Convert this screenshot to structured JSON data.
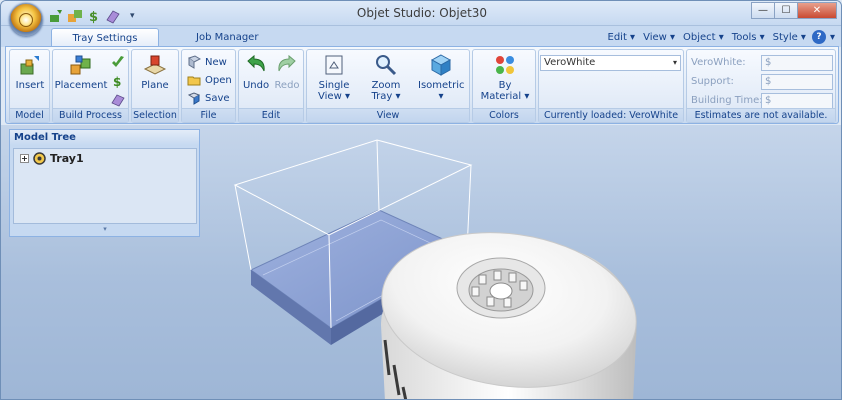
{
  "window": {
    "title": "Objet Studio: Objet30"
  },
  "qat": {
    "icons": [
      "insert-icon",
      "build-icon",
      "dollar-icon",
      "eraser-icon"
    ],
    "menu_glyph": "▾"
  },
  "controls": {
    "minimize": "—",
    "maximize": "☐",
    "close": "✕"
  },
  "tabs": [
    "Tray Settings",
    "Job Manager"
  ],
  "menus": [
    "Edit ▾",
    "View ▾",
    "Object ▾",
    "Tools ▾",
    "Style ▾"
  ],
  "help": {
    "glyph": "?",
    "arrow": "▾"
  },
  "ribbon": {
    "model": {
      "label": "Model",
      "insert": "Insert"
    },
    "build": {
      "label": "Build Process",
      "placement": "Placement"
    },
    "selection": {
      "label": "Selection",
      "plane": "Plane"
    },
    "file": {
      "label": "File",
      "new": "New",
      "open": "Open",
      "save": "Save"
    },
    "edit": {
      "label": "Edit",
      "undo": "Undo",
      "redo": "Redo"
    },
    "view": {
      "label": "View",
      "single_view": "Single View ▾",
      "zoom_tray": "Zoom Tray ▾",
      "isometric": "Isometric ▾"
    },
    "colors": {
      "label": "Colors",
      "by_material": "By Material ▾"
    },
    "material": {
      "label": "Currently loaded: VeroWhite",
      "selected": "VeroWhite"
    },
    "estimates": {
      "label": "Estimates are not available.",
      "verowhite_label": "VeroWhite:",
      "support_label": "Support:",
      "building_time_label": "Building Time:",
      "verowhite_value": "$",
      "support_value": "$",
      "building_time_value": "$"
    }
  },
  "tree": {
    "title": "Model Tree",
    "item": "Tray1",
    "expander": "+",
    "footer": "▾"
  }
}
